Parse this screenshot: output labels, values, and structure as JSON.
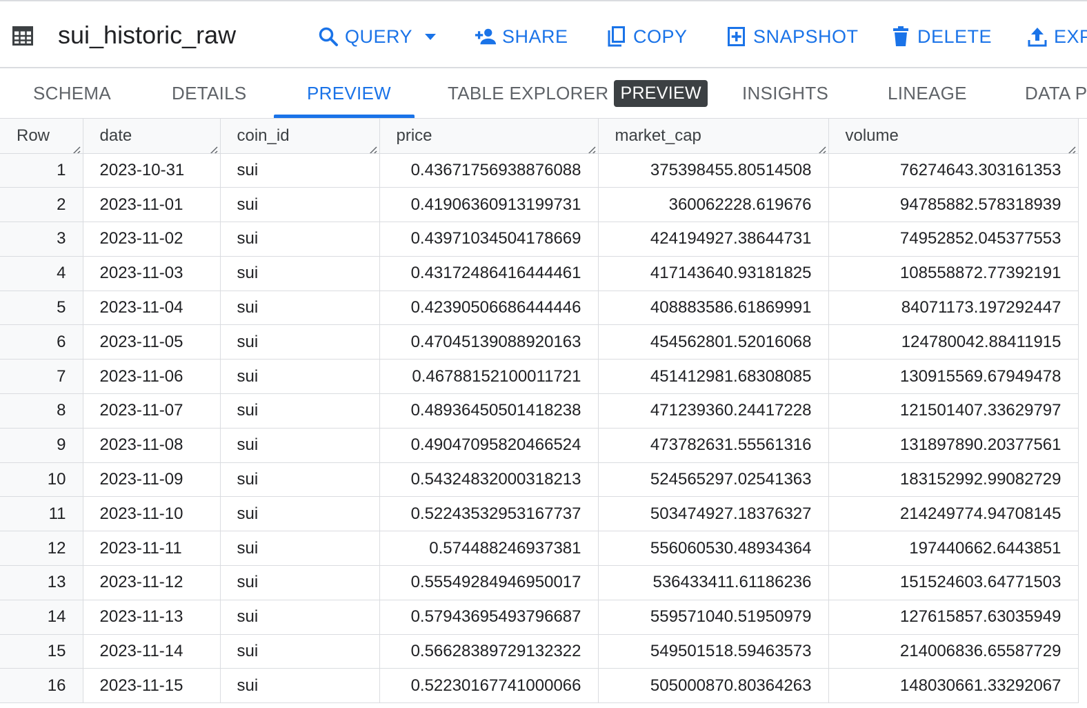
{
  "header": {
    "title": "sui_historic_raw",
    "actions": {
      "query": "QUERY",
      "share": "SHARE",
      "copy": "COPY",
      "snapshot": "SNAPSHOT",
      "delete": "DELETE",
      "export": "EXP"
    }
  },
  "tabs": {
    "schema": "SCHEMA",
    "details": "DETAILS",
    "preview": "PREVIEW",
    "table_explorer": "TABLE EXPLORER",
    "table_explorer_badge": "PREVIEW",
    "insights": "INSIGHTS",
    "lineage": "LINEAGE",
    "data_profile": "DATA P"
  },
  "active_tab": "PREVIEW",
  "colors": {
    "accent": "#1a73e8",
    "badge_bg": "#3c4043",
    "border": "#dadce0",
    "header_bg": "#f8f9fa"
  },
  "grid": {
    "columns": [
      "Row",
      "date",
      "coin_id",
      "price",
      "market_cap",
      "volume"
    ],
    "rows": [
      [
        "1",
        "2023-10-31",
        "sui",
        "0.43671756938876088",
        "375398455.80514508",
        "76274643.303161353"
      ],
      [
        "2",
        "2023-11-01",
        "sui",
        "0.41906360913199731",
        "360062228.619676",
        "94785882.578318939"
      ],
      [
        "3",
        "2023-11-02",
        "sui",
        "0.43971034504178669",
        "424194927.38644731",
        "74952852.045377553"
      ],
      [
        "4",
        "2023-11-03",
        "sui",
        "0.43172486416444461",
        "417143640.93181825",
        "108558872.77392191"
      ],
      [
        "5",
        "2023-11-04",
        "sui",
        "0.42390506686444446",
        "408883586.61869991",
        "84071173.197292447"
      ],
      [
        "6",
        "2023-11-05",
        "sui",
        "0.47045139088920163",
        "454562801.52016068",
        "124780042.88411915"
      ],
      [
        "7",
        "2023-11-06",
        "sui",
        "0.46788152100011721",
        "451412981.68308085",
        "130915569.67949478"
      ],
      [
        "8",
        "2023-11-07",
        "sui",
        "0.48936450501418238",
        "471239360.24417228",
        "121501407.33629797"
      ],
      [
        "9",
        "2023-11-08",
        "sui",
        "0.49047095820466524",
        "473782631.55561316",
        "131897890.20377561"
      ],
      [
        "10",
        "2023-11-09",
        "sui",
        "0.54324832000318213",
        "524565297.02541363",
        "183152992.99082729"
      ],
      [
        "11",
        "2023-11-10",
        "sui",
        "0.52243532953167737",
        "503474927.18376327",
        "214249774.94708145"
      ],
      [
        "12",
        "2023-11-11",
        "sui",
        "0.574488246937381",
        "556060530.48934364",
        "197440662.6443851"
      ],
      [
        "13",
        "2023-11-12",
        "sui",
        "0.55549284946950017",
        "536433411.61186236",
        "151524603.64771503"
      ],
      [
        "14",
        "2023-11-13",
        "sui",
        "0.57943695493796687",
        "559571040.51950979",
        "127615857.63035949"
      ],
      [
        "15",
        "2023-11-14",
        "sui",
        "0.56628389729132322",
        "549501518.59463573",
        "214006836.65587729"
      ],
      [
        "16",
        "2023-11-15",
        "sui",
        "0.52230167741000066",
        "505000870.80364263",
        "148030661.33292067"
      ]
    ]
  }
}
